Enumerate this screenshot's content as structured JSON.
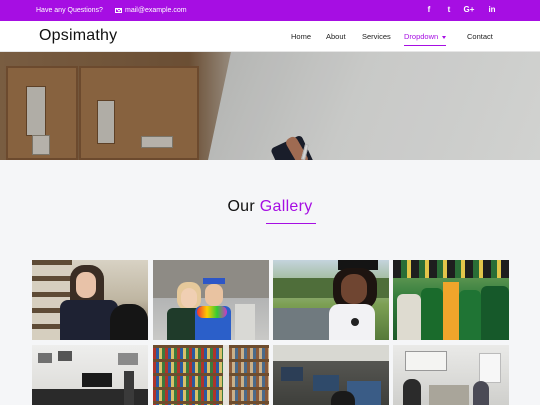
{
  "topbar": {
    "question": "Have any Questions?",
    "email": "mail@example.com",
    "social": [
      {
        "name": "facebook-icon",
        "glyph": "f"
      },
      {
        "name": "twitter-icon",
        "glyph": "t"
      },
      {
        "name": "google-plus-icon",
        "glyph": "G+"
      },
      {
        "name": "linkedin-icon",
        "glyph": "in"
      }
    ]
  },
  "brand": "Opsimathy",
  "nav": {
    "home": "Home",
    "about": "About",
    "services": "Services",
    "dropdown": "Dropdown",
    "contact": "Contact"
  },
  "gallery": {
    "title_a": "Our",
    "title_b": "Gallery",
    "items": [
      "student-thinking-photo",
      "graduates-selfie-photo",
      "graduate-smiling-photo",
      "graduation-ceremony-photo",
      "classroom-photo",
      "library-shelves-photo",
      "computer-lab-photo",
      "meeting-room-photo"
    ]
  },
  "colors": {
    "accent": "#a60ee3"
  }
}
